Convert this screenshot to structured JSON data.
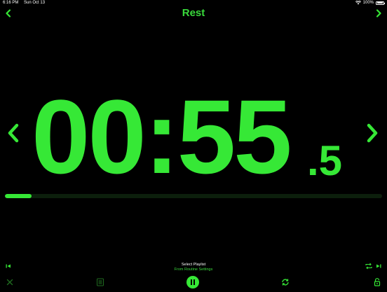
{
  "status_bar": {
    "time": "6:16 PM",
    "date": "Sun Oct 13",
    "battery": "100%"
  },
  "header": {
    "title": "Rest",
    "left_icon": "close-icon",
    "right_icon": "chevron-down-icon"
  },
  "timer": {
    "main": "00:55",
    "tenths": ".5",
    "prev_icon": "chevron-left-icon",
    "next_icon": "chevron-right-icon"
  },
  "progress": {
    "fraction": 0.07
  },
  "playlist": {
    "title": "Select Playlist",
    "subtitle": "From Routine Settings"
  },
  "colors": {
    "accent": "#36e836",
    "background": "#000000",
    "track": "#0c1f0c"
  },
  "toolbar": {
    "icons": [
      "close-icon",
      "list-icon",
      "pause-icon",
      "repeat-icon",
      "lock-icon"
    ]
  }
}
